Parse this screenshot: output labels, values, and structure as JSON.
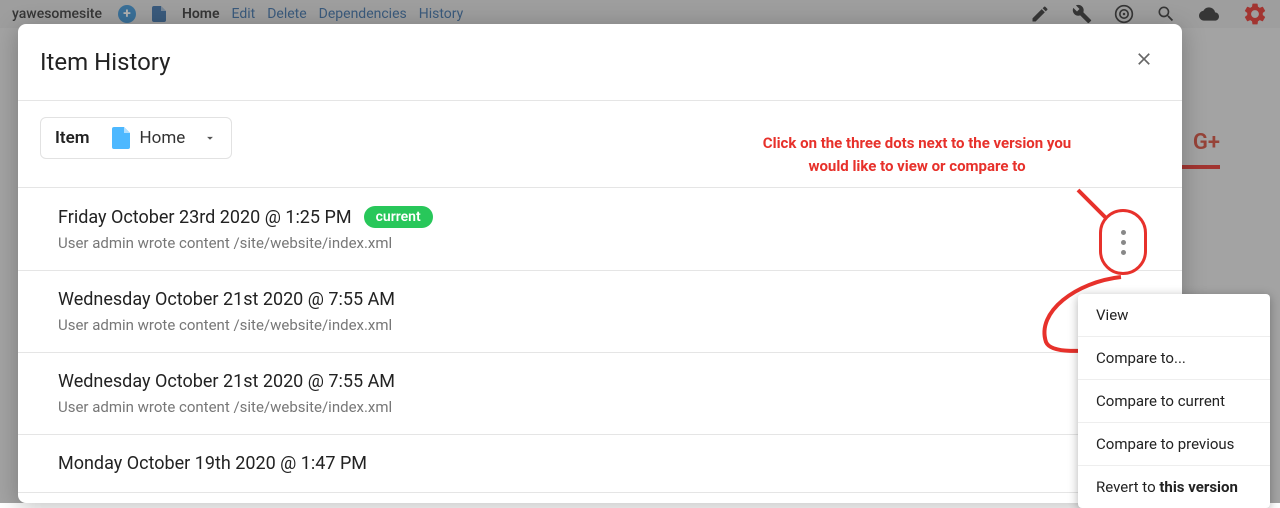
{
  "bg": {
    "site": "yawesomesite",
    "nav": [
      "Home",
      "Edit",
      "Delete",
      "Dependencies",
      "History"
    ],
    "gplus": "G+"
  },
  "modal": {
    "title": "Item History",
    "filter_label": "Item",
    "item_name": "Home",
    "instruction": "Click on the three dots next to the version you would like to view or compare to"
  },
  "history": [
    {
      "ts": "Friday October 23rd 2020 @ 1:25 PM",
      "badge": "current",
      "desc": "User admin wrote content /site/website/index.xml"
    },
    {
      "ts": "Wednesday October 21st 2020 @ 7:55 AM",
      "badge": null,
      "desc": "User admin wrote content /site/website/index.xml"
    },
    {
      "ts": "Wednesday October 21st 2020 @ 7:55 AM",
      "badge": null,
      "desc": "User admin wrote content /site/website/index.xml"
    },
    {
      "ts": "Monday October 19th 2020 @ 1:47 PM",
      "badge": null,
      "desc": ""
    }
  ],
  "menu": {
    "view": "View",
    "compare_to": "Compare to...",
    "compare_current": "Compare to current",
    "compare_previous": "Compare to previous",
    "revert_prefix": "Revert to ",
    "revert_bold": "this version"
  }
}
